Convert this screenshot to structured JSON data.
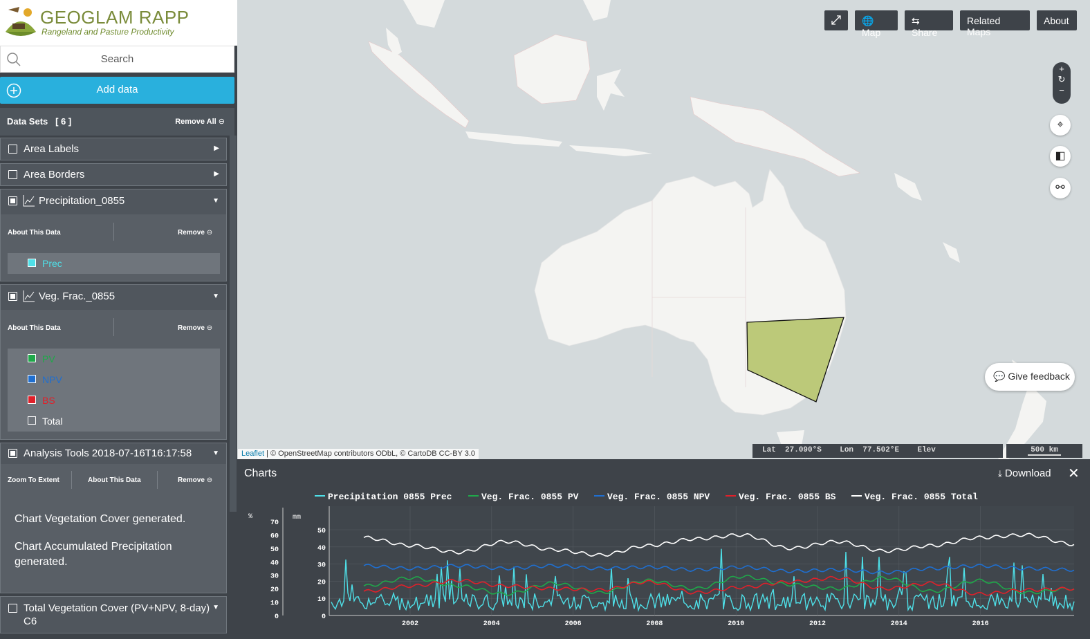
{
  "app": {
    "name": "GEOGLAM RAPP",
    "subtitle": "Rangeland and Pasture Productivity"
  },
  "sidebar": {
    "search_placeholder": "Search",
    "add_data_label": "Add data",
    "datasets_header": "Data Sets",
    "datasets_count": "[ 6 ]",
    "remove_all_label": "Remove All",
    "items": [
      {
        "label": "Area Labels"
      },
      {
        "label": "Area Borders"
      },
      {
        "label": "Precipitation_0855",
        "about": "About This Data",
        "remove": "Remove",
        "legend": [
          {
            "label": "Prec",
            "color": "#4ee0e8"
          }
        ]
      },
      {
        "label": "Veg. Frac._0855",
        "about": "About This Data",
        "remove": "Remove",
        "legend": [
          {
            "label": "PV",
            "color": "#1fa84a"
          },
          {
            "label": "NPV",
            "color": "#1f6fd0"
          },
          {
            "label": "BS",
            "color": "#e0202a"
          },
          {
            "label": "Total",
            "color": "#ffffff"
          }
        ]
      },
      {
        "label": "Analysis Tools 2018-07-16T16:17:58",
        "zoom": "Zoom To Extent",
        "about": "About This Data",
        "remove": "Remove",
        "messages": [
          "Chart Vegetation Cover generated.",
          "Chart Accumulated Precipitation generated."
        ]
      },
      {
        "label": "Total Vegetation Cover (PV+NPV, 8-day) C6"
      }
    ]
  },
  "toolbar": {
    "map_label": "Map",
    "share_label": "Share",
    "related_label": "Related Maps",
    "about_label": "About"
  },
  "feedback_label": "Give feedback",
  "attribution": {
    "leaflet": "Leaflet",
    "rest": "| © OpenStreetMap contributors ODbL, © CartoDB CC-BY 3.0"
  },
  "status": {
    "lat_label": "Lat",
    "lat": "27.090°S",
    "lon_label": "Lon",
    "lon": "77.502°E",
    "elev_label": "Elev",
    "scale": "500 km"
  },
  "charts_panel": {
    "title": "Charts",
    "download_label": "Download"
  },
  "chart_data": {
    "type": "line",
    "series": [
      {
        "name": "Precipitation 0855 Prec",
        "color": "#4ee0e8"
      },
      {
        "name": "Veg. Frac. 0855 PV",
        "color": "#1fa84a"
      },
      {
        "name": "Veg. Frac. 0855 NPV",
        "color": "#1f6fd0"
      },
      {
        "name": "Veg. Frac. 0855 BS",
        "color": "#e0202a"
      },
      {
        "name": "Veg. Frac. 0855 Total",
        "color": "#ffffff"
      }
    ],
    "x_ticks": [
      "2002",
      "2004",
      "2006",
      "2008",
      "2010",
      "2012",
      "2014",
      "2016"
    ],
    "y_left_label": "%",
    "y_left_ticks": [
      "0",
      "10",
      "20",
      "30",
      "40",
      "50",
      "60",
      "70"
    ],
    "y_right_label": "mm",
    "y_right_ticks": [
      "0",
      "10",
      "20",
      "30",
      "40",
      "50"
    ],
    "total_approx": [
      58,
      52,
      47,
      55,
      49,
      45,
      52,
      57,
      60,
      50,
      55,
      48,
      52,
      58,
      60,
      53
    ],
    "npv_approx": [
      37,
      35,
      37,
      35,
      37,
      35,
      36,
      34,
      36,
      33,
      34,
      32,
      35,
      37,
      35,
      34
    ],
    "pv_approx": [
      22,
      28,
      22,
      16,
      24,
      17,
      26,
      20,
      29,
      23,
      20,
      28,
      18,
      26,
      17,
      20
    ],
    "bs_approx": [
      18,
      22,
      26,
      22,
      20,
      19,
      25,
      17,
      21,
      25,
      28,
      20,
      24,
      16,
      19,
      20
    ]
  }
}
